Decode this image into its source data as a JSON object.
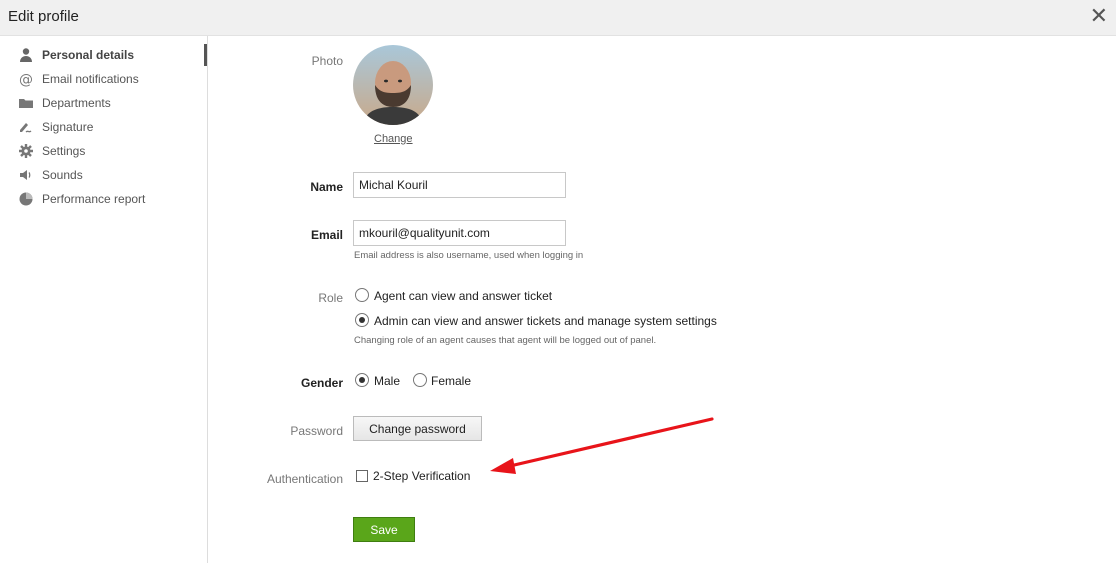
{
  "header": {
    "title": "Edit profile",
    "close_icon": "close-icon"
  },
  "sidebar": {
    "items": [
      {
        "label": "Personal details",
        "icon": "person-icon",
        "active": true
      },
      {
        "label": "Email notifications",
        "icon": "at-sign-icon"
      },
      {
        "label": "Departments",
        "icon": "folder-icon"
      },
      {
        "label": "Signature",
        "icon": "signature-icon"
      },
      {
        "label": "Settings",
        "icon": "gear-icon"
      },
      {
        "label": "Sounds",
        "icon": "speaker-icon"
      },
      {
        "label": "Performance report",
        "icon": "pie-chart-icon"
      }
    ]
  },
  "form": {
    "photo": {
      "label": "Photo",
      "change_link": "Change"
    },
    "name": {
      "label": "Name",
      "value": "Michal Kouril"
    },
    "email": {
      "label": "Email",
      "value": "mkouril@qualityunit.com",
      "hint": "Email address is also username, used when logging in"
    },
    "role": {
      "label": "Role",
      "options": [
        {
          "label": "Agent can view and answer ticket",
          "selected": false
        },
        {
          "label": "Admin can view and answer tickets and manage system settings",
          "selected": true
        }
      ],
      "hint": "Changing role of an agent causes that agent will be logged out of panel."
    },
    "gender": {
      "label": "Gender",
      "options": [
        {
          "label": "Male",
          "selected": true
        },
        {
          "label": "Female",
          "selected": false
        }
      ]
    },
    "password": {
      "label": "Password",
      "button": "Change password"
    },
    "authentication": {
      "label": "Authentication",
      "checkbox_label": "2-Step Verification",
      "checked": false
    },
    "save_button": "Save"
  },
  "colors": {
    "save_green": "#5aa61a",
    "arrow_red": "#e8141a"
  }
}
